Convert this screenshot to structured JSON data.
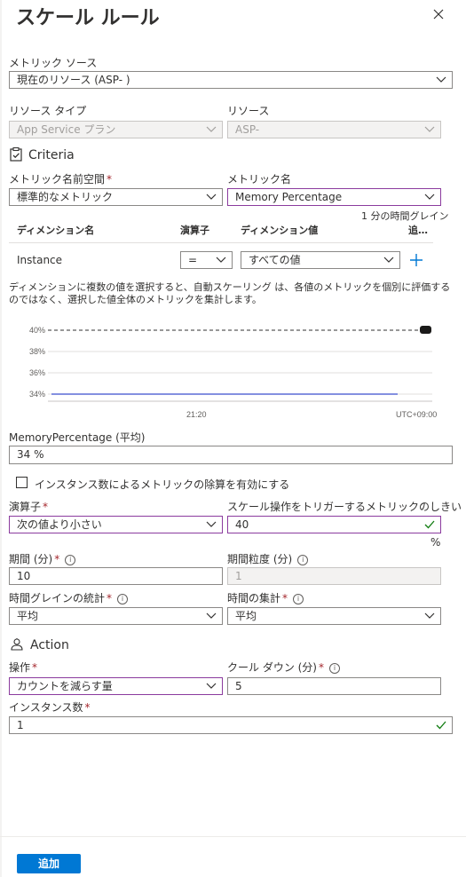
{
  "title": "スケール ルール",
  "metric_source": {
    "label": "メトリック ソース",
    "value": "現在のリソース (ASP-       )"
  },
  "resource_type": {
    "label": "リソース タイプ",
    "value": "App Service プラン"
  },
  "resource": {
    "label": "リソース",
    "value": "ASP-"
  },
  "criteria": {
    "title": "Criteria"
  },
  "metric_namespace": {
    "label": "メトリック名前空間",
    "value": "標準的なメトリック"
  },
  "metric_name": {
    "label": "メトリック名",
    "value": "Memory Percentage"
  },
  "time_grain_note": "1 分の時間グレイン",
  "dimension_table": {
    "headers": [
      "ディメンション名",
      "演算子",
      "ディメンション値",
      "追…"
    ],
    "row": {
      "name": "Instance",
      "operator": "=",
      "value": "すべての値"
    }
  },
  "dimension_note": "ディメンションに複数の値を選択すると、自動スケーリング は、各値のメトリックを個別に評価するのではなく、選択した値全体のメトリックを集計します。",
  "chart_data": {
    "type": "line",
    "y_ticks": [
      "40%",
      "38%",
      "36%",
      "34%"
    ],
    "ylim": [
      34,
      40
    ],
    "x_ticks": [
      "21:20"
    ],
    "timezone_label": "UTC+09:00",
    "threshold": 40,
    "series": [
      {
        "values": [
          34,
          34,
          34,
          34,
          34,
          34,
          34,
          34,
          34,
          34
        ]
      }
    ],
    "colors": {
      "series": "#5c6bd6",
      "threshold": "#323130"
    }
  },
  "metric_summary": {
    "label": "MemoryPercentage (平均)",
    "value": "34 %"
  },
  "divide_checkbox": {
    "label": "インスタンス数によるメトリックの除算を有効にする",
    "checked": false
  },
  "operator": {
    "label": "演算子",
    "value": "次の値より小さい"
  },
  "threshold": {
    "label": "スケール操作をトリガーするメトリックのしきい値",
    "value": "40",
    "unit": "%"
  },
  "duration": {
    "label": "期間 (分)",
    "value": "10"
  },
  "time_grain": {
    "label": "期間粒度 (分)",
    "value": "1"
  },
  "time_grain_stat": {
    "label": "時間グレインの統計",
    "value": "平均"
  },
  "time_aggregation": {
    "label": "時間の集計",
    "value": "平均"
  },
  "action": {
    "title": "Action"
  },
  "operation": {
    "label": "操作",
    "value": "カウントを減らす量"
  },
  "cooldown": {
    "label": "クール ダウン (分)",
    "value": "5"
  },
  "instance_count": {
    "label": "インスタンス数",
    "value": "1"
  },
  "add_button": "追加",
  "required_mark": "*"
}
